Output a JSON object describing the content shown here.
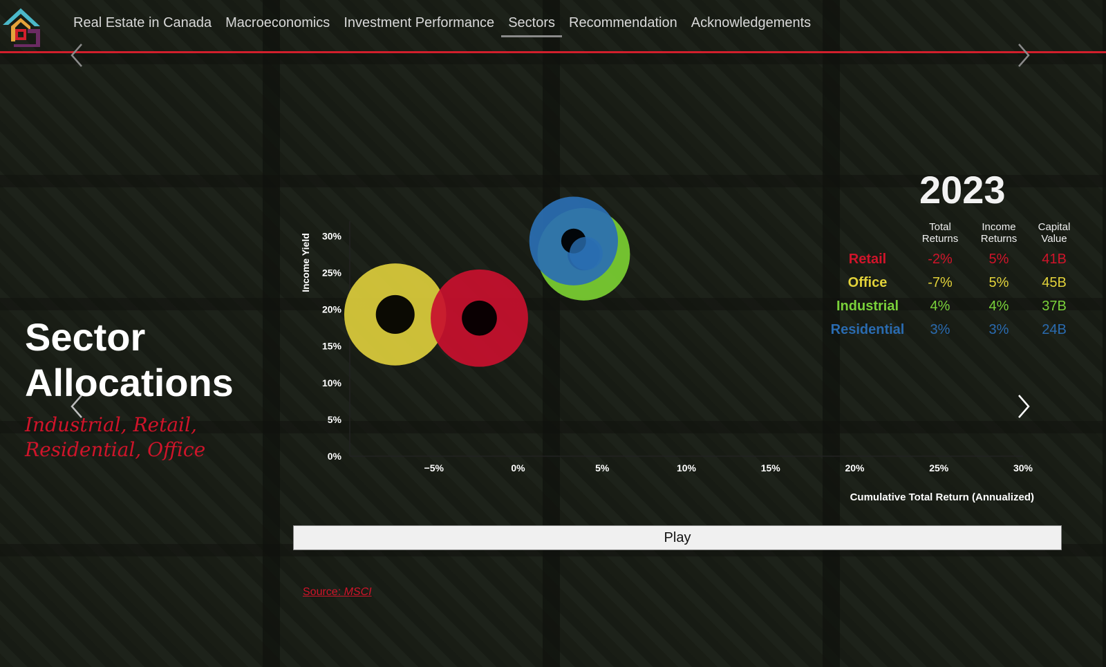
{
  "nav": {
    "items": [
      {
        "label": "Real Estate in Canada"
      },
      {
        "label": "Macroeconomics"
      },
      {
        "label": "Investment Performance"
      },
      {
        "label": "Sectors"
      },
      {
        "label": "Recommendation"
      },
      {
        "label": "Acknowledgements"
      }
    ],
    "active": "Sectors"
  },
  "hero": {
    "title_line1": "Sector",
    "title_line2": "Allocations",
    "subtitle_line1": "Industrial, Retail,",
    "subtitle_line2": "Residential, Office"
  },
  "year": "2023",
  "table": {
    "headers": {
      "total": [
        "Total",
        "Returns"
      ],
      "income": [
        "Income",
        "Returns"
      ],
      "capital": [
        "Capital",
        "Value"
      ]
    },
    "rows": [
      {
        "sector": "Retail",
        "total": "-2%",
        "income": "5%",
        "capital": "41B",
        "color": "#d0142a"
      },
      {
        "sector": "Office",
        "total": "-7%",
        "income": "5%",
        "capital": "45B",
        "color": "#e2d23a"
      },
      {
        "sector": "Industrial",
        "total": "4%",
        "income": "4%",
        "capital": "37B",
        "color": "#7ad13a"
      },
      {
        "sector": "Residential",
        "total": "3%",
        "income": "3%",
        "capital": "24B",
        "color": "#2a6bb0"
      }
    ]
  },
  "chart_data": {
    "type": "scatter",
    "xlabel": "Cumulative Total Return (Annualized)",
    "ylabel": "Income Yield",
    "xlim": [
      -10,
      30
    ],
    "ylim": [
      0,
      32
    ],
    "x_ticks": [
      "−5%",
      "0%",
      "5%",
      "10%",
      "15%",
      "20%",
      "25%",
      "30%"
    ],
    "x_tick_values": [
      -5,
      0,
      5,
      10,
      15,
      20,
      25,
      30
    ],
    "y_ticks": [
      "0%",
      "5%",
      "10%",
      "15%",
      "20%",
      "25%",
      "30%"
    ],
    "y_tick_values": [
      0,
      5,
      10,
      15,
      20,
      25,
      30
    ],
    "series": [
      {
        "name": "Office",
        "x": -7.3,
        "y": 19.3,
        "capital": 45,
        "color": "#dccd3c",
        "hole": 0.38
      },
      {
        "name": "Retail",
        "x": -2.3,
        "y": 18.8,
        "capital": 41,
        "color": "#c8102e",
        "hole": 0.36
      },
      {
        "name": "Industrial",
        "x": 3.9,
        "y": 27.5,
        "capital": 37,
        "color": "#7bcf32",
        "hole": 0.35
      },
      {
        "name": "Residential",
        "x": 3.3,
        "y": 29.3,
        "capital": 34,
        "color": "#2a6fb3",
        "hole": 0.28
      }
    ]
  },
  "play_label": "Play",
  "source": {
    "prefix": "Source: ",
    "name": "MSCI"
  },
  "colors": {
    "accent": "#d21f2c"
  }
}
